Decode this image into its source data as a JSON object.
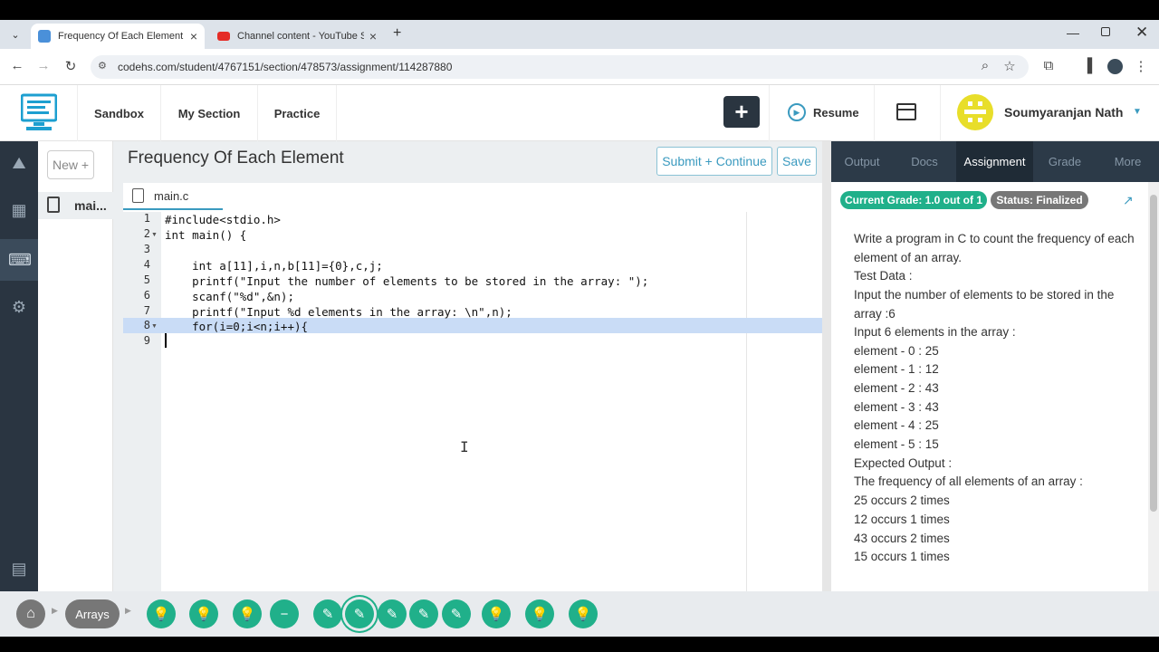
{
  "browser": {
    "tabs": [
      {
        "title": "Frequency Of Each Element | Co",
        "active": true
      },
      {
        "title": "Channel content - YouTube Stu",
        "active": false
      }
    ],
    "url": "codehs.com/student/4767151/section/478573/assignment/114287880"
  },
  "header": {
    "nav": [
      "Sandbox",
      "My Section",
      "Practice"
    ],
    "resume_label": "Resume",
    "user_name": "Soumyaranjan Nath"
  },
  "sidebar": {
    "new_label": "New +",
    "file_label": "mai..."
  },
  "editor": {
    "title": "Frequency Of Each Element",
    "submit_label": "Submit + Continue",
    "save_label": "Save",
    "file_tab": "main.c",
    "lines": [
      "#include<stdio.h>",
      "int main() {",
      "",
      "    int a[11],i,n,b[11]={0},c,j;",
      "    printf(\"Input the number of elements to be stored in the array: \");",
      "    scanf(\"%d\",&n);",
      "    printf(\"Input %d elements in the array: \\n\",n);",
      "    for(i=0;i<n;i++){",
      ""
    ],
    "line_numbers": [
      "1",
      "2",
      "3",
      "4",
      "5",
      "6",
      "7",
      "8",
      "9"
    ]
  },
  "panel": {
    "tabs": [
      "Output",
      "Docs",
      "Assignment",
      "Grade",
      "More"
    ],
    "active_tab": "Assignment",
    "grade_badge": "Current Grade: 1.0 out of 1",
    "status_badge": "Status: Finalized",
    "description": [
      "Write a program in C to count the frequency of each element of an array.",
      "Test Data :",
      "Input the number of elements to be stored in the array :6",
      "Input 6 elements in the array :",
      "element - 0 : 25",
      "element - 1 : 12",
      "element - 2 : 43",
      "element - 3 : 43",
      "element - 4 : 25",
      "element - 5 : 15",
      "Expected Output :",
      "The frequency of all elements of an array :",
      "25 occurs 2 times",
      "12 occurs 1 times",
      "43 occurs 2 times",
      "15 occurs 1 times"
    ]
  },
  "bottom": {
    "section_label": "Arrays"
  },
  "colors": {
    "accent": "#3a9abf",
    "green": "#20b08a",
    "dark": "#2a3541"
  }
}
